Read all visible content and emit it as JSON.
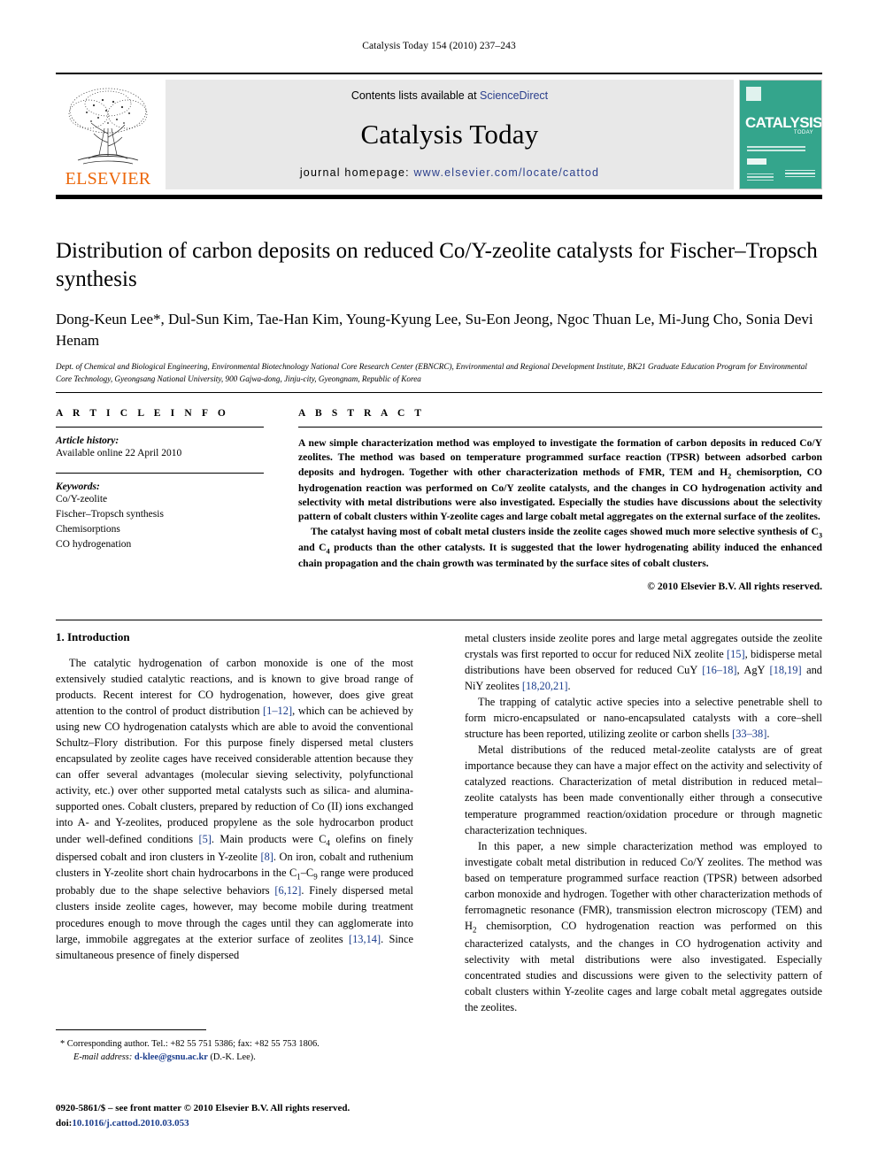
{
  "running_head": "Catalysis Today 154 (2010) 237–243",
  "masthead": {
    "contents_prefix": "Contents lists available at ",
    "contents_link": "ScienceDirect",
    "journal_title": "Catalysis Today",
    "homepage_prefix": "journal homepage: ",
    "homepage_url": "www.elsevier.com/locate/cattod",
    "publisher_wordmark": "ELSEVIER",
    "cover": {
      "main_text": "CATALYSIS",
      "sub_text": "TODAY"
    }
  },
  "article": {
    "title": "Distribution of carbon deposits on reduced Co/Y-zeolite catalysts for Fischer–Tropsch synthesis",
    "authors": "Dong-Keun Lee*, Dul-Sun Kim, Tae-Han Kim, Young-Kyung Lee, Su-Eon Jeong, Ngoc Thuan Le, Mi-Jung Cho, Sonia Devi Henam",
    "affiliation": "Dept. of Chemical and Biological Engineering, Environmental Biotechnology National Core Research Center (EBNCRC), Environmental and Regional Development Institute, BK21 Graduate Education Program for Environmental Core Technology, Gyeongsang National University, 900 Gajwa-dong, Jinju-city, Gyeongnam, Republic of Korea"
  },
  "info": {
    "heading": "A R T I C L E   I N F O",
    "history_label": "Article history:",
    "history_value": "Available online 22 April 2010",
    "keywords_label": "Keywords:",
    "keywords": [
      "Co/Y-zeolite",
      "Fischer–Tropsch synthesis",
      "Chemisorptions",
      "CO hydrogenation"
    ]
  },
  "abstract": {
    "heading": "A B S T R A C T",
    "paragraphs": [
      "A new simple characterization method was employed to investigate the formation of carbon deposits in reduced Co/Y zeolites. The method was based on temperature programmed surface reaction (TPSR) between adsorbed carbon deposits and hydrogen. Together with other characterization methods of FMR, TEM and H2 chemisorption, CO hydrogenation reaction was performed on Co/Y zeolite catalysts, and the changes in CO hydrogenation activity and selectivity with metal distributions were also investigated. Especially the studies have discussions about the selectivity pattern of cobalt clusters within Y-zeolite cages and large cobalt metal aggregates on the external surface of the zeolites.",
      "The catalyst having most of cobalt metal clusters inside the zeolite cages showed much more selective synthesis of C3 and C4 products than the other catalysts. It is suggested that the lower hydrogenating ability induced the enhanced chain propagation and the chain growth was terminated by the surface sites of cobalt clusters."
    ],
    "copyright": "© 2010 Elsevier B.V. All rights reserved."
  },
  "introduction": {
    "section_number_title": "1.  Introduction",
    "left_paragraphs": [
      "The catalytic hydrogenation of carbon monoxide is one of the most extensively studied catalytic reactions, and is known to give broad range of products. Recent interest for CO hydrogenation, however, does give great attention to the control of product distribution [1–12], which can be achieved by using new CO hydrogenation catalysts which are able to avoid the conventional Schultz–Flory distribution. For this purpose finely dispersed metal clusters encapsulated by zeolite cages have received considerable attention because they can offer several advantages (molecular sieving selectivity, polyfunctional activity, etc.) over other supported metal catalysts such as silica- and alumina-supported ones. Cobalt clusters, prepared by reduction of Co (II) ions exchanged into A- and Y-zeolites, produced propylene as the sole hydrocarbon product under well-defined conditions [5]. Main products were C4 olefins on finely dispersed cobalt and iron clusters in Y-zeolite [8]. On iron, cobalt and ruthenium clusters in Y-zeolite short chain hydrocarbons in the C1–C9 range were produced probably due to the shape selective behaviors [6,12]. Finely dispersed metal clusters inside zeolite cages, however, may become mobile during treatment procedures enough to move through the cages until they can agglomerate into large, immobile aggregates at the exterior surface of zeolites [13,14]. Since simultaneous presence of finely dispersed"
    ],
    "right_paragraphs": [
      "metal clusters inside zeolite pores and large metal aggregates outside the zeolite crystals was first reported to occur for reduced NiX zeolite [15], bidisperse metal distributions have been observed for reduced CuY [16–18], AgY [18,19] and NiY zeolites [18,20,21].",
      "The trapping of catalytic active species into a selective penetrable shell to form micro-encapsulated or nano-encapsulated catalysts with a core–shell structure has been reported, utilizing zeolite or carbon shells [33–38].",
      "Metal distributions of the reduced metal-zeolite catalysts are of great importance because they can have a major effect on the activity and selectivity of catalyzed reactions. Characterization of metal distribution in reduced metal–zeolite catalysts has been made conventionally either through a consecutive temperature programmed reaction/oxidation procedure or through magnetic characterization techniques.",
      "In this paper, a new simple characterization method was employed to investigate cobalt metal distribution in reduced Co/Y zeolites. The method was based on temperature programmed surface reaction (TPSR) between adsorbed carbon monoxide and hydrogen. Together with other characterization methods of ferromagnetic resonance (FMR), transmission electron microscopy (TEM) and H2 chemisorption, CO hydrogenation reaction was performed on this characterized catalysts, and the changes in CO hydrogenation activity and selectivity with metal distributions were also investigated. Especially concentrated studies and discussions were given to the selectivity pattern of cobalt clusters within Y-zeolite cages and large cobalt metal aggregates outside the zeolites."
    ]
  },
  "footnote": {
    "corresponding": "* Corresponding author. Tel.: +82 55 751 5386; fax: +82 55 753 1806.",
    "email_label": "E-mail address:",
    "email": "d-klee@gsnu.ac.kr",
    "email_suffix": " (D.-K. Lee).",
    "issn_line": "0920-5861/$ – see front matter © 2010 Elsevier B.V. All rights reserved.",
    "doi_label": "doi:",
    "doi_value": "10.1016/j.cattod.2010.03.053"
  },
  "colors": {
    "link_blue": "#2b3f8c",
    "ref_blue": "#1a3c8c",
    "elsevier_orange": "#ec6608",
    "cover_teal": "#34a58c"
  }
}
